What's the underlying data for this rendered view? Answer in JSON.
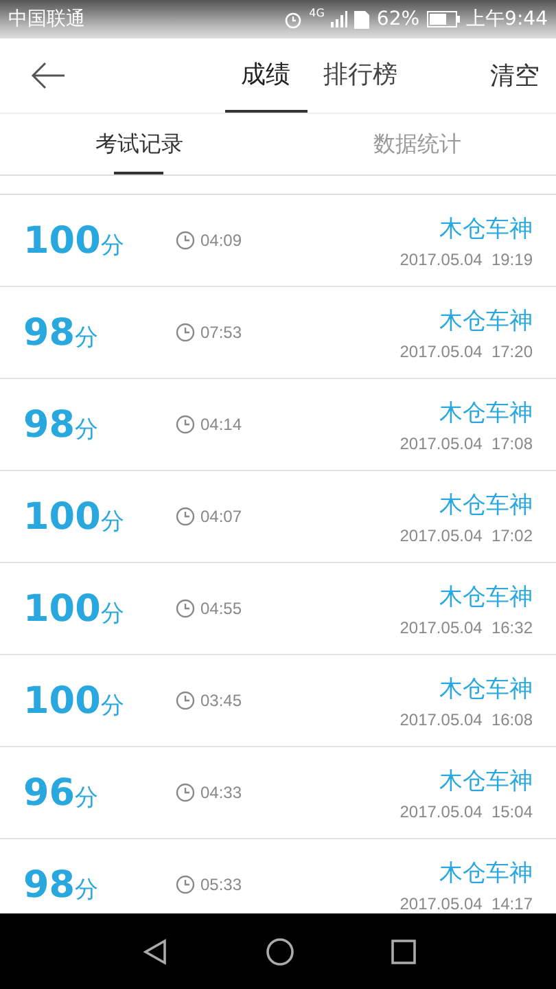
{
  "status_bar": {
    "carrier": "中国联通",
    "network": "4G",
    "battery": "62%",
    "time": "上午9:44"
  },
  "header": {
    "tabs": [
      {
        "label": "成绩",
        "selected": true
      },
      {
        "label": "排行榜",
        "selected": false
      }
    ],
    "action": "清空"
  },
  "sub_tabs": [
    {
      "label": "考试记录",
      "selected": true
    },
    {
      "label": "数据统计",
      "selected": false
    }
  ],
  "records": [
    {
      "score": "100",
      "unit": "分",
      "duration": "04:09",
      "name": "木仓车神",
      "date": "2017.05.04  19:19"
    },
    {
      "score": "98",
      "unit": "分",
      "duration": "07:53",
      "name": "木仓车神",
      "date": "2017.05.04  17:20"
    },
    {
      "score": "98",
      "unit": "分",
      "duration": "04:14",
      "name": "木仓车神",
      "date": "2017.05.04  17:08"
    },
    {
      "score": "100",
      "unit": "分",
      "duration": "04:07",
      "name": "木仓车神",
      "date": "2017.05.04  17:02"
    },
    {
      "score": "100",
      "unit": "分",
      "duration": "04:55",
      "name": "木仓车神",
      "date": "2017.05.04  16:32"
    },
    {
      "score": "100",
      "unit": "分",
      "duration": "03:45",
      "name": "木仓车神",
      "date": "2017.05.04  16:08"
    },
    {
      "score": "96",
      "unit": "分",
      "duration": "04:33",
      "name": "木仓车神",
      "date": "2017.05.04  15:04"
    },
    {
      "score": "98",
      "unit": "分",
      "duration": "05:33",
      "name": "木仓车神",
      "date": "2017.05.04  14:17"
    }
  ]
}
